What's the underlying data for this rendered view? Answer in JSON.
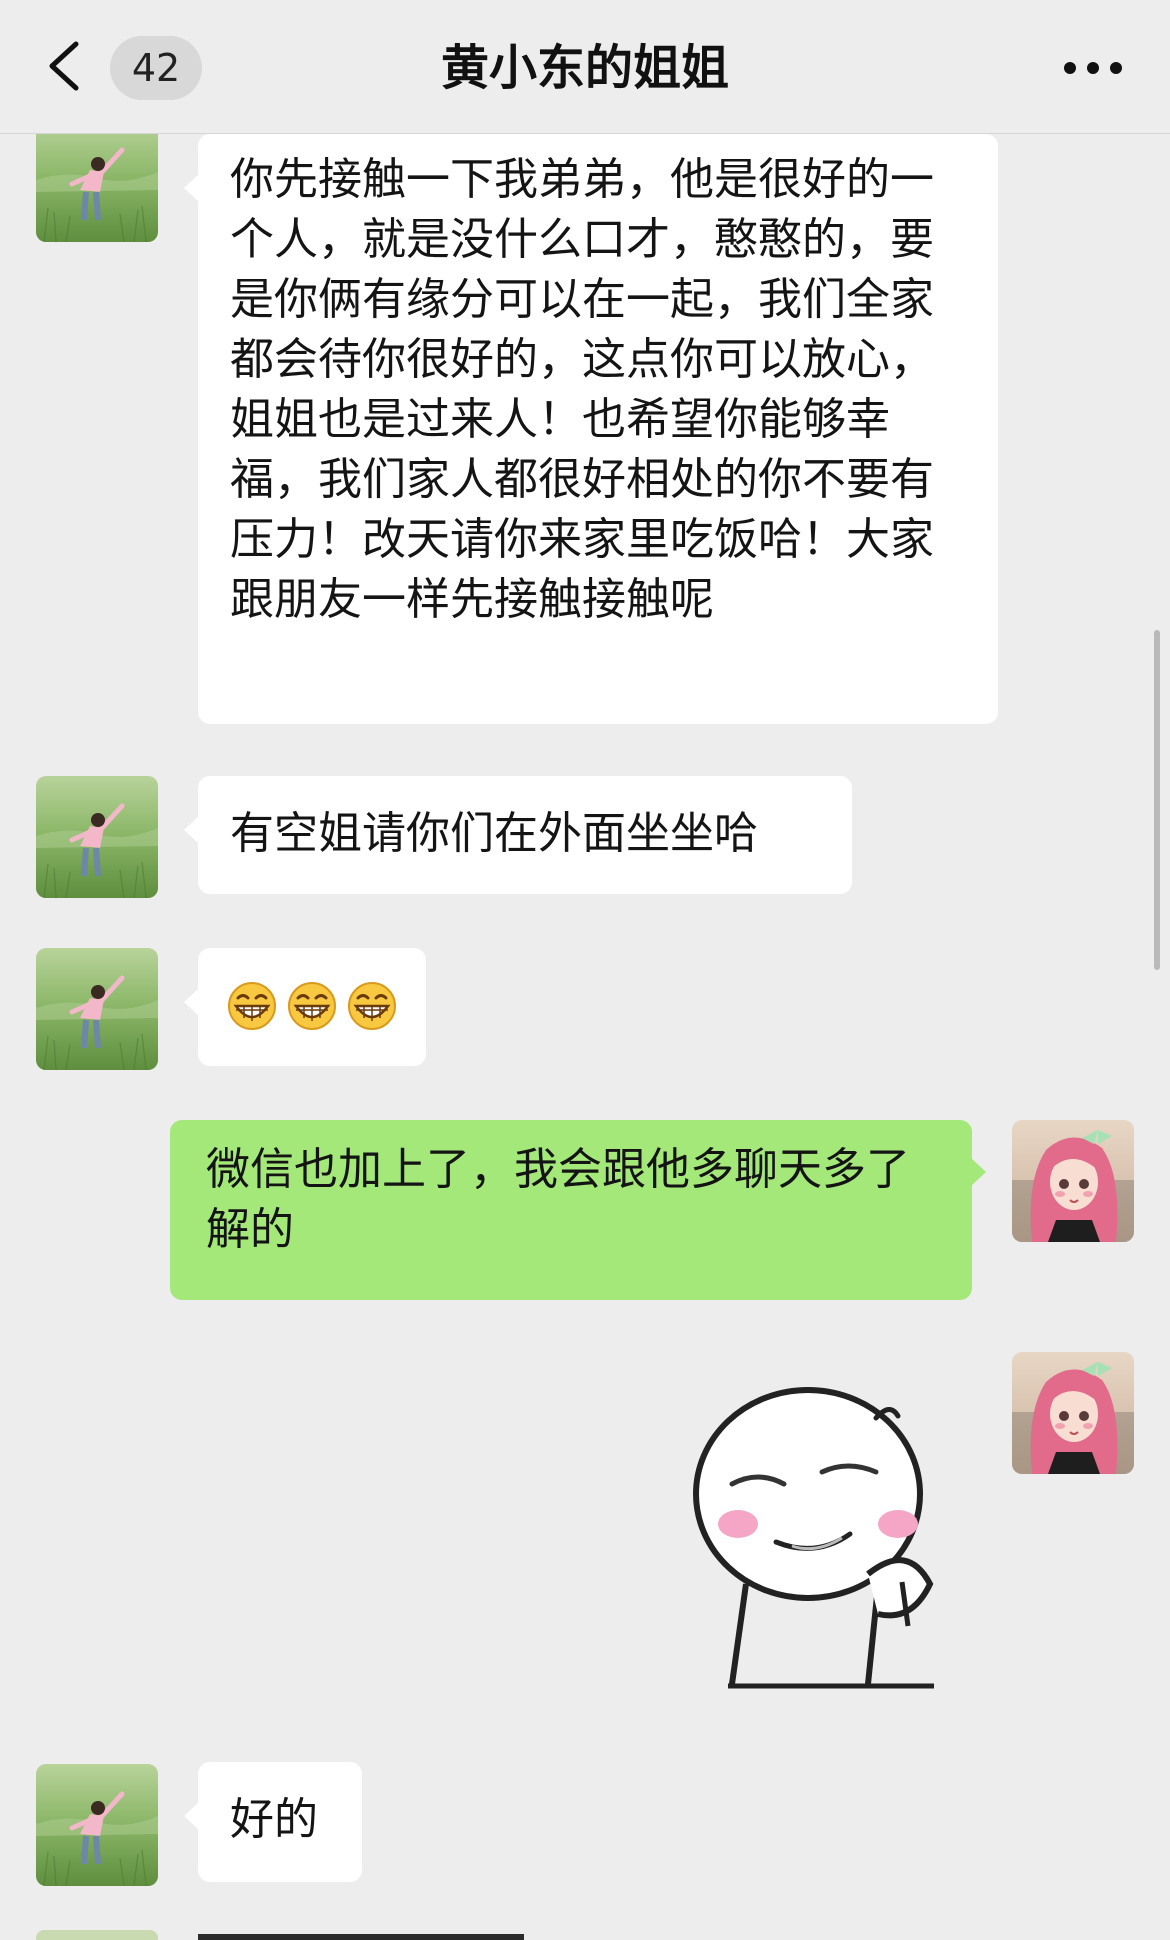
{
  "header": {
    "unread_count": "42",
    "title": "黄小东的姐姐"
  },
  "messages": [
    {
      "side": "left",
      "type": "text",
      "text": "你先接触一下我弟弟，他是很好的一个人，就是没什么口才，憨憨的，要是你俩有缘分可以在一起，我们全家都会待你很好的，这点你可以放心，姐姐也是过来人！也希望你能够幸福，我们家人都很好相处的你不要有压力！改天请你来家里吃饭哈！大家跟朋友一样先接触接触呢"
    },
    {
      "side": "left",
      "type": "text",
      "text": "有空姐请你们在外面坐坐哈"
    },
    {
      "side": "left",
      "type": "emoji",
      "emoji": [
        "grin-emoji",
        "grin-emoji",
        "grin-emoji"
      ]
    },
    {
      "side": "right",
      "type": "text",
      "text": "微信也加上了，我会跟他多聊天多了解的"
    },
    {
      "side": "right",
      "type": "sticker",
      "sticker": "thinking-face-sticker"
    },
    {
      "side": "left",
      "type": "text",
      "text": "好的"
    }
  ],
  "colors": {
    "background": "#EDEDED",
    "bubble_incoming": "#FFFFFF",
    "bubble_outgoing": "#A4E87A"
  }
}
